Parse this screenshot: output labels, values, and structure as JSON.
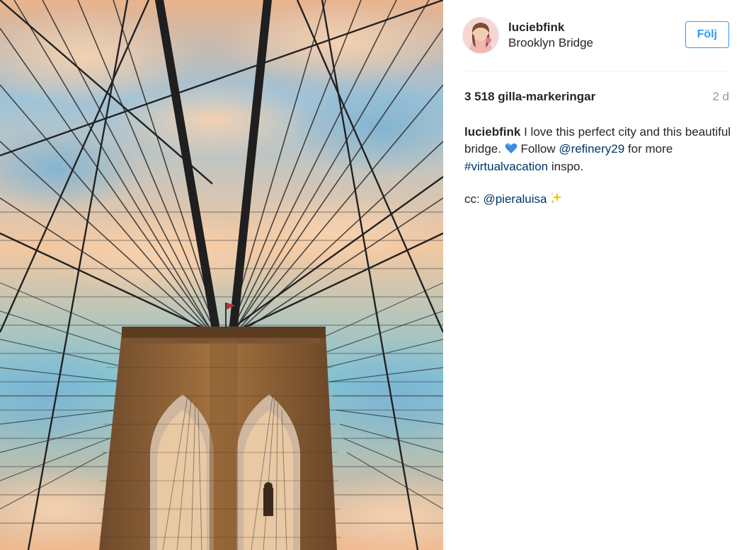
{
  "post": {
    "user": {
      "username": "luciebfink",
      "location": "Brooklyn Bridge",
      "follow_label": "Följ"
    },
    "likes_text": "3 518 gilla-markeringar",
    "time_ago": "2 d",
    "caption": {
      "username": "luciebfink",
      "text_part1": "I love this perfect city and this beautiful bridge.",
      "emoji_heart": "blue-heart",
      "text_part2": "Follow",
      "mention1": "@refinery29",
      "text_part3": "for more",
      "hashtag": "#virtualvacation",
      "text_part4": "inspo.",
      "cc_label": "cc:",
      "mention2": "@pieraluisa",
      "emoji_sparkles": "sparkles"
    },
    "colors": {
      "accent_blue": "#3897f0",
      "link_blue": "#003569",
      "muted_gray": "#999999",
      "text": "#262626"
    }
  }
}
